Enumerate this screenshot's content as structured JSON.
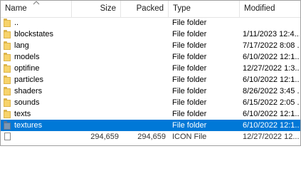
{
  "columns": {
    "name": "Name",
    "size": "Size",
    "packed": "Packed",
    "type": "Type",
    "modified": "Modified"
  },
  "rows": [
    {
      "name": "..",
      "size": "",
      "packed": "",
      "type": "File folder",
      "modified": "",
      "icon": "folder-icon",
      "selected": false
    },
    {
      "name": "blockstates",
      "size": "",
      "packed": "",
      "type": "File folder",
      "modified": "1/11/2023 12:4...",
      "icon": "folder-icon",
      "selected": false
    },
    {
      "name": "lang",
      "size": "",
      "packed": "",
      "type": "File folder",
      "modified": "7/17/2022 8:08 ...",
      "icon": "folder-icon",
      "selected": false
    },
    {
      "name": "models",
      "size": "",
      "packed": "",
      "type": "File folder",
      "modified": "6/10/2022 12:1...",
      "icon": "folder-icon",
      "selected": false
    },
    {
      "name": "optifine",
      "size": "",
      "packed": "",
      "type": "File folder",
      "modified": "12/27/2022 1:3...",
      "icon": "folder-icon",
      "selected": false
    },
    {
      "name": "particles",
      "size": "",
      "packed": "",
      "type": "File folder",
      "modified": "6/10/2022 12:1...",
      "icon": "folder-icon",
      "selected": false
    },
    {
      "name": "shaders",
      "size": "",
      "packed": "",
      "type": "File folder",
      "modified": "8/26/2022 3:45 ...",
      "icon": "folder-icon",
      "selected": false
    },
    {
      "name": "sounds",
      "size": "",
      "packed": "",
      "type": "File folder",
      "modified": "6/15/2022 2:05 ...",
      "icon": "folder-icon",
      "selected": false
    },
    {
      "name": "texts",
      "size": "",
      "packed": "",
      "type": "File folder",
      "modified": "6/10/2022 12:1...",
      "icon": "folder-icon",
      "selected": false
    },
    {
      "name": "textures",
      "size": "",
      "packed": "",
      "type": "File folder",
      "modified": "6/10/2022 12:1...",
      "icon": "folder-icon",
      "selected": true
    },
    {
      "name": "",
      "size": "294,659",
      "packed": "294,659",
      "type": "ICON File",
      "modified": "12/27/2022 12...",
      "icon": "file-icon",
      "selected": false
    }
  ],
  "colors": {
    "selection": "#0078d7",
    "folder": "#f7d36b"
  }
}
